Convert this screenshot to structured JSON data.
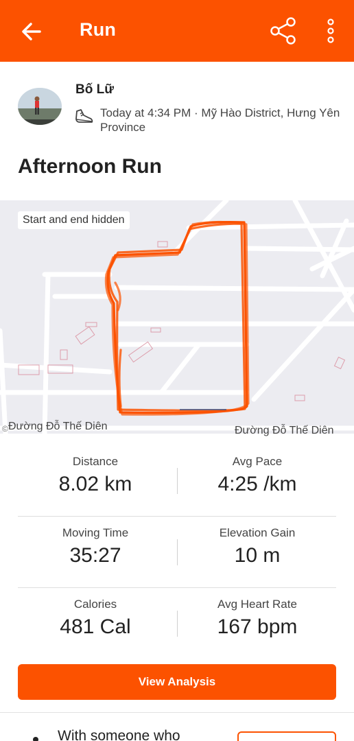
{
  "app_bar": {
    "title": "Run"
  },
  "athlete": {
    "name": "Bố Lữ"
  },
  "activity": {
    "meta": "Today at 4:34 PM · Mỹ Hào District, Hưng Yên Province",
    "title": "Afternoon Run"
  },
  "map": {
    "badge": "Start and end hidden",
    "street_left": "Đường Đỗ Thế Diên",
    "street_right": "Đường Đỗ Thế Diên",
    "copyright": "©"
  },
  "stats": [
    {
      "label": "Distance",
      "value": "8.02 km"
    },
    {
      "label": "Avg Pace",
      "value": "4:25 /km"
    },
    {
      "label": "Moving Time",
      "value": "35:27"
    },
    {
      "label": "Elevation Gain",
      "value": "10 m"
    },
    {
      "label": "Calories",
      "value": "481 Cal"
    },
    {
      "label": "Avg Heart Rate",
      "value": "167 bpm"
    }
  ],
  "actions": {
    "view_analysis": "View Analysis"
  },
  "bottom": {
    "text": "With someone who"
  },
  "colors": {
    "brand": "#fc5200",
    "route": "#fc5200",
    "map_bg": "#ececf1"
  }
}
